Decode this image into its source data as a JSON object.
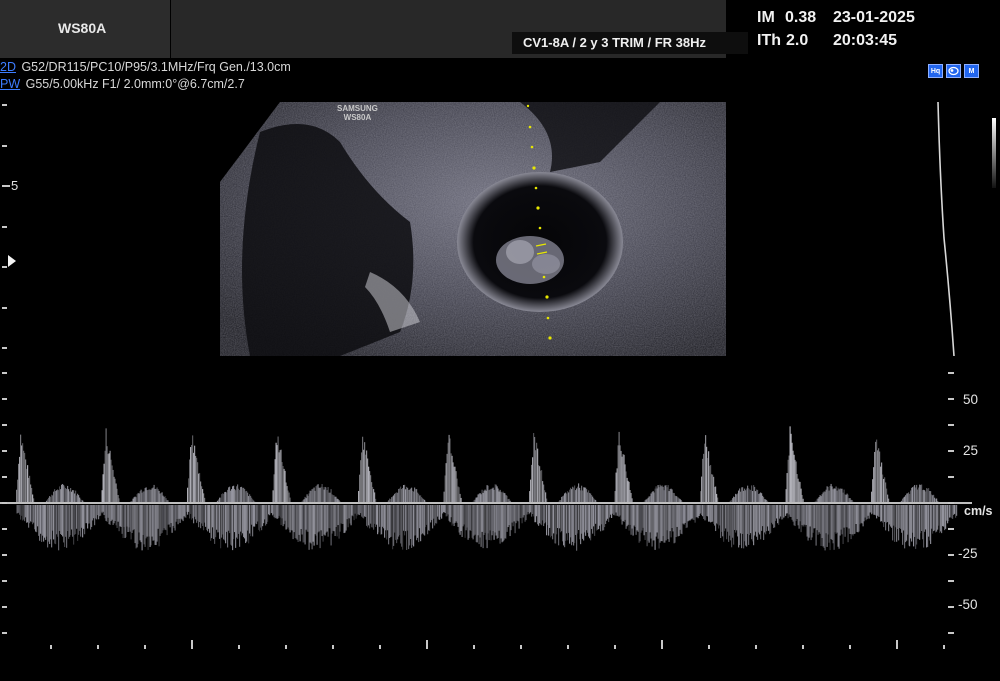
{
  "header": {
    "system_name": "WS80A",
    "probe_preset": "CV1-8A / 2 y 3 TRIM / FR 38Hz",
    "mi_label": "IM",
    "mi_value": "0.38",
    "ti_label": "ITh",
    "ti_value": "2.0",
    "date": "23-01-2025",
    "time": "20:03:45"
  },
  "params": {
    "bmode_tag": "2D",
    "bmode_params": " G52/DR115/PC10/P95/3.1MHz/Frq Gen./13.0cm",
    "pw_tag": "PW",
    "pw_params": " G55/5.00kHz F1/ 2.0mm:0°@6.7cm/2.7"
  },
  "image_logo": [
    "SAMSUNG",
    "WS80A"
  ],
  "depth_scale": {
    "label": "5"
  },
  "icons": [
    "hq-icon",
    "fetus-icon",
    "m-icon"
  ],
  "icon_texts": {
    "hq": "Hq",
    "fetus": "",
    "m": "M"
  },
  "doppler": {
    "velocity_labels": [
      "50",
      "25",
      "-25",
      "-50"
    ],
    "unit": "cm/s"
  },
  "colors": {
    "mode_tag": "#3d7dff",
    "sample_gate": "#e8e800",
    "background": "#000000"
  }
}
